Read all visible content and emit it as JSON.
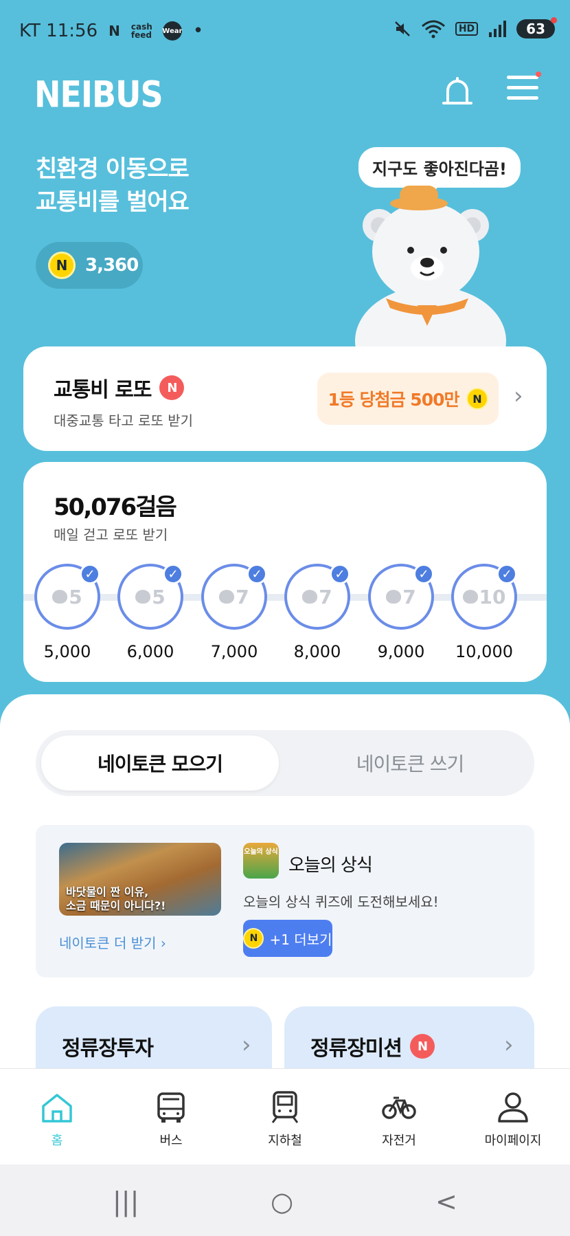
{
  "status_bar": {
    "carrier_time": "KT 11:56",
    "app_icons": [
      "N",
      "cash feed",
      "Wear",
      "•"
    ],
    "right_icons": [
      "mute-icon",
      "wifi-icon",
      "HD",
      "signal-icon"
    ],
    "battery": "63"
  },
  "header": {
    "logo": "NEIBUS"
  },
  "hero": {
    "headline_line1": "친환경 이동으로",
    "headline_line2": "교통비를 벌어요",
    "balance": "3,360",
    "coin_letter": "N",
    "bubble": "지구도 좋아진다곰!"
  },
  "lotto": {
    "title": "교통비 로또",
    "badge": "N",
    "subtitle": "대중교통 타고 로또 받기",
    "prize": "1등 당첨금 500만",
    "prize_coin": "N"
  },
  "steps": {
    "title": "50,076걸음",
    "subtitle": "매일 걷고 로또 받기",
    "items": [
      {
        "reward": "5",
        "goal": "5,000"
      },
      {
        "reward": "5",
        "goal": "6,000"
      },
      {
        "reward": "7",
        "goal": "7,000"
      },
      {
        "reward": "7",
        "goal": "8,000"
      },
      {
        "reward": "7",
        "goal": "9,000"
      },
      {
        "reward": "10",
        "goal": "10,000"
      }
    ]
  },
  "tabs": {
    "collect": "네이토큰 모으기",
    "spend": "네이토큰 쓰기"
  },
  "quiz": {
    "thumb_line1": "바닷물이 짠 이유,",
    "thumb_line2": "소금 때문이 아니다?!",
    "more_link": "네이토큰 더 받기",
    "app_icon_text": "오늘의 상식",
    "title": "오늘의 상식",
    "subtitle": "오늘의 상식 퀴즈에 도전해보세요!",
    "button": "+1 더보기",
    "button_coin": "N"
  },
  "mini_cards": {
    "invest": "정류장투자",
    "mission": "정류장미션",
    "mission_badge": "N"
  },
  "nav": {
    "home": "홈",
    "bus": "버스",
    "subway": "지하철",
    "bike": "자전거",
    "mypage": "마이페이지"
  },
  "system_nav": {
    "recent": "|||",
    "home": "○",
    "back": "<"
  },
  "colors": {
    "background": "#57bfdb",
    "accent_nav": "#35c7d6",
    "progress_blue": "#4d7ee0",
    "prize_orange": "#f07a28"
  }
}
